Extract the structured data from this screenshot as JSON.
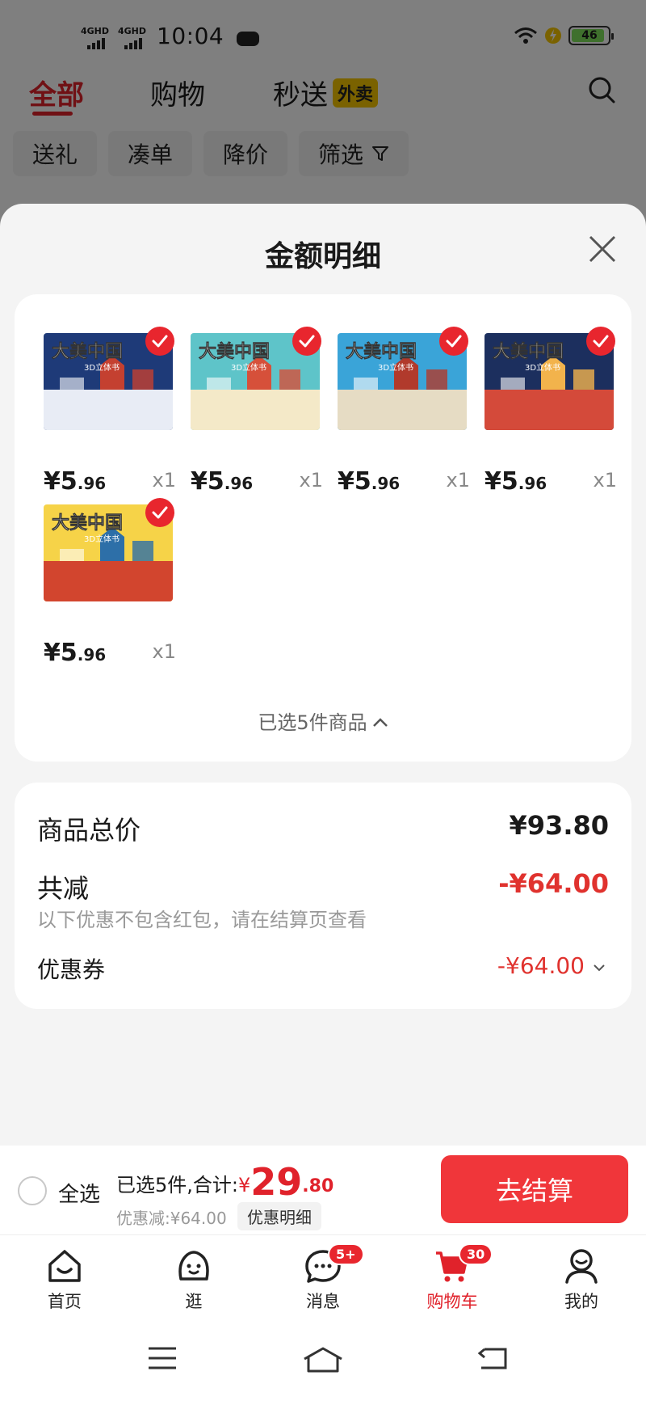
{
  "status_bar": {
    "network_1": "4GHD",
    "network_2": "4GHD",
    "time": "10:04",
    "battery": "46"
  },
  "top_tabs": [
    {
      "label": "全部",
      "active": true
    },
    {
      "label": "购物",
      "active": false
    },
    {
      "label": "秒送",
      "active": false
    }
  ],
  "top_tab_badge": "外卖",
  "filters": [
    "送礼",
    "凑单",
    "降价",
    "筛选"
  ],
  "sheet": {
    "title": "金额明细",
    "products": [
      {
        "price_int": "¥5",
        "price_dec": ".96",
        "qty": "x1",
        "checked": true
      },
      {
        "price_int": "¥5",
        "price_dec": ".96",
        "qty": "x1",
        "checked": true
      },
      {
        "price_int": "¥5",
        "price_dec": ".96",
        "qty": "x1",
        "checked": true
      },
      {
        "price_int": "¥5",
        "price_dec": ".96",
        "qty": "x1",
        "checked": true
      },
      {
        "price_int": "¥5",
        "price_dec": ".96",
        "qty": "x1",
        "checked": true
      }
    ],
    "product_cover_title": "大美中国",
    "product_cover_subtitle": "3D立体书",
    "selected_toggle": "已选5件商品",
    "summary": {
      "total_label": "商品总价",
      "total_value": "¥93.80",
      "reduce_label": "共减",
      "reduce_value": "-¥64.00",
      "note": "以下优惠不包含红包，请在结算页查看",
      "coupon_label": "优惠券",
      "coupon_value": "-¥64.00"
    }
  },
  "checkout": {
    "select_all": "全选",
    "total_prefix": "已选5件,合计:",
    "currency": "¥",
    "total_int": "29",
    "total_dec": ".80",
    "discount": "优惠减:¥64.00",
    "detail_button": "优惠明细",
    "pay_button": "去结算"
  },
  "bottom_nav": [
    {
      "label": "首页",
      "icon": "home-icon"
    },
    {
      "label": "逛",
      "icon": "face-icon"
    },
    {
      "label": "消息",
      "icon": "message-icon",
      "badge": "5+"
    },
    {
      "label": "购物车",
      "icon": "cart-icon",
      "badge": "30",
      "active": true
    },
    {
      "label": "我的",
      "icon": "profile-icon"
    }
  ],
  "colors": {
    "accent_red": "#e0222b",
    "discount_red": "#e0322e",
    "pay_button": "#f0363a",
    "waimai_yellow": "#f4c500"
  }
}
